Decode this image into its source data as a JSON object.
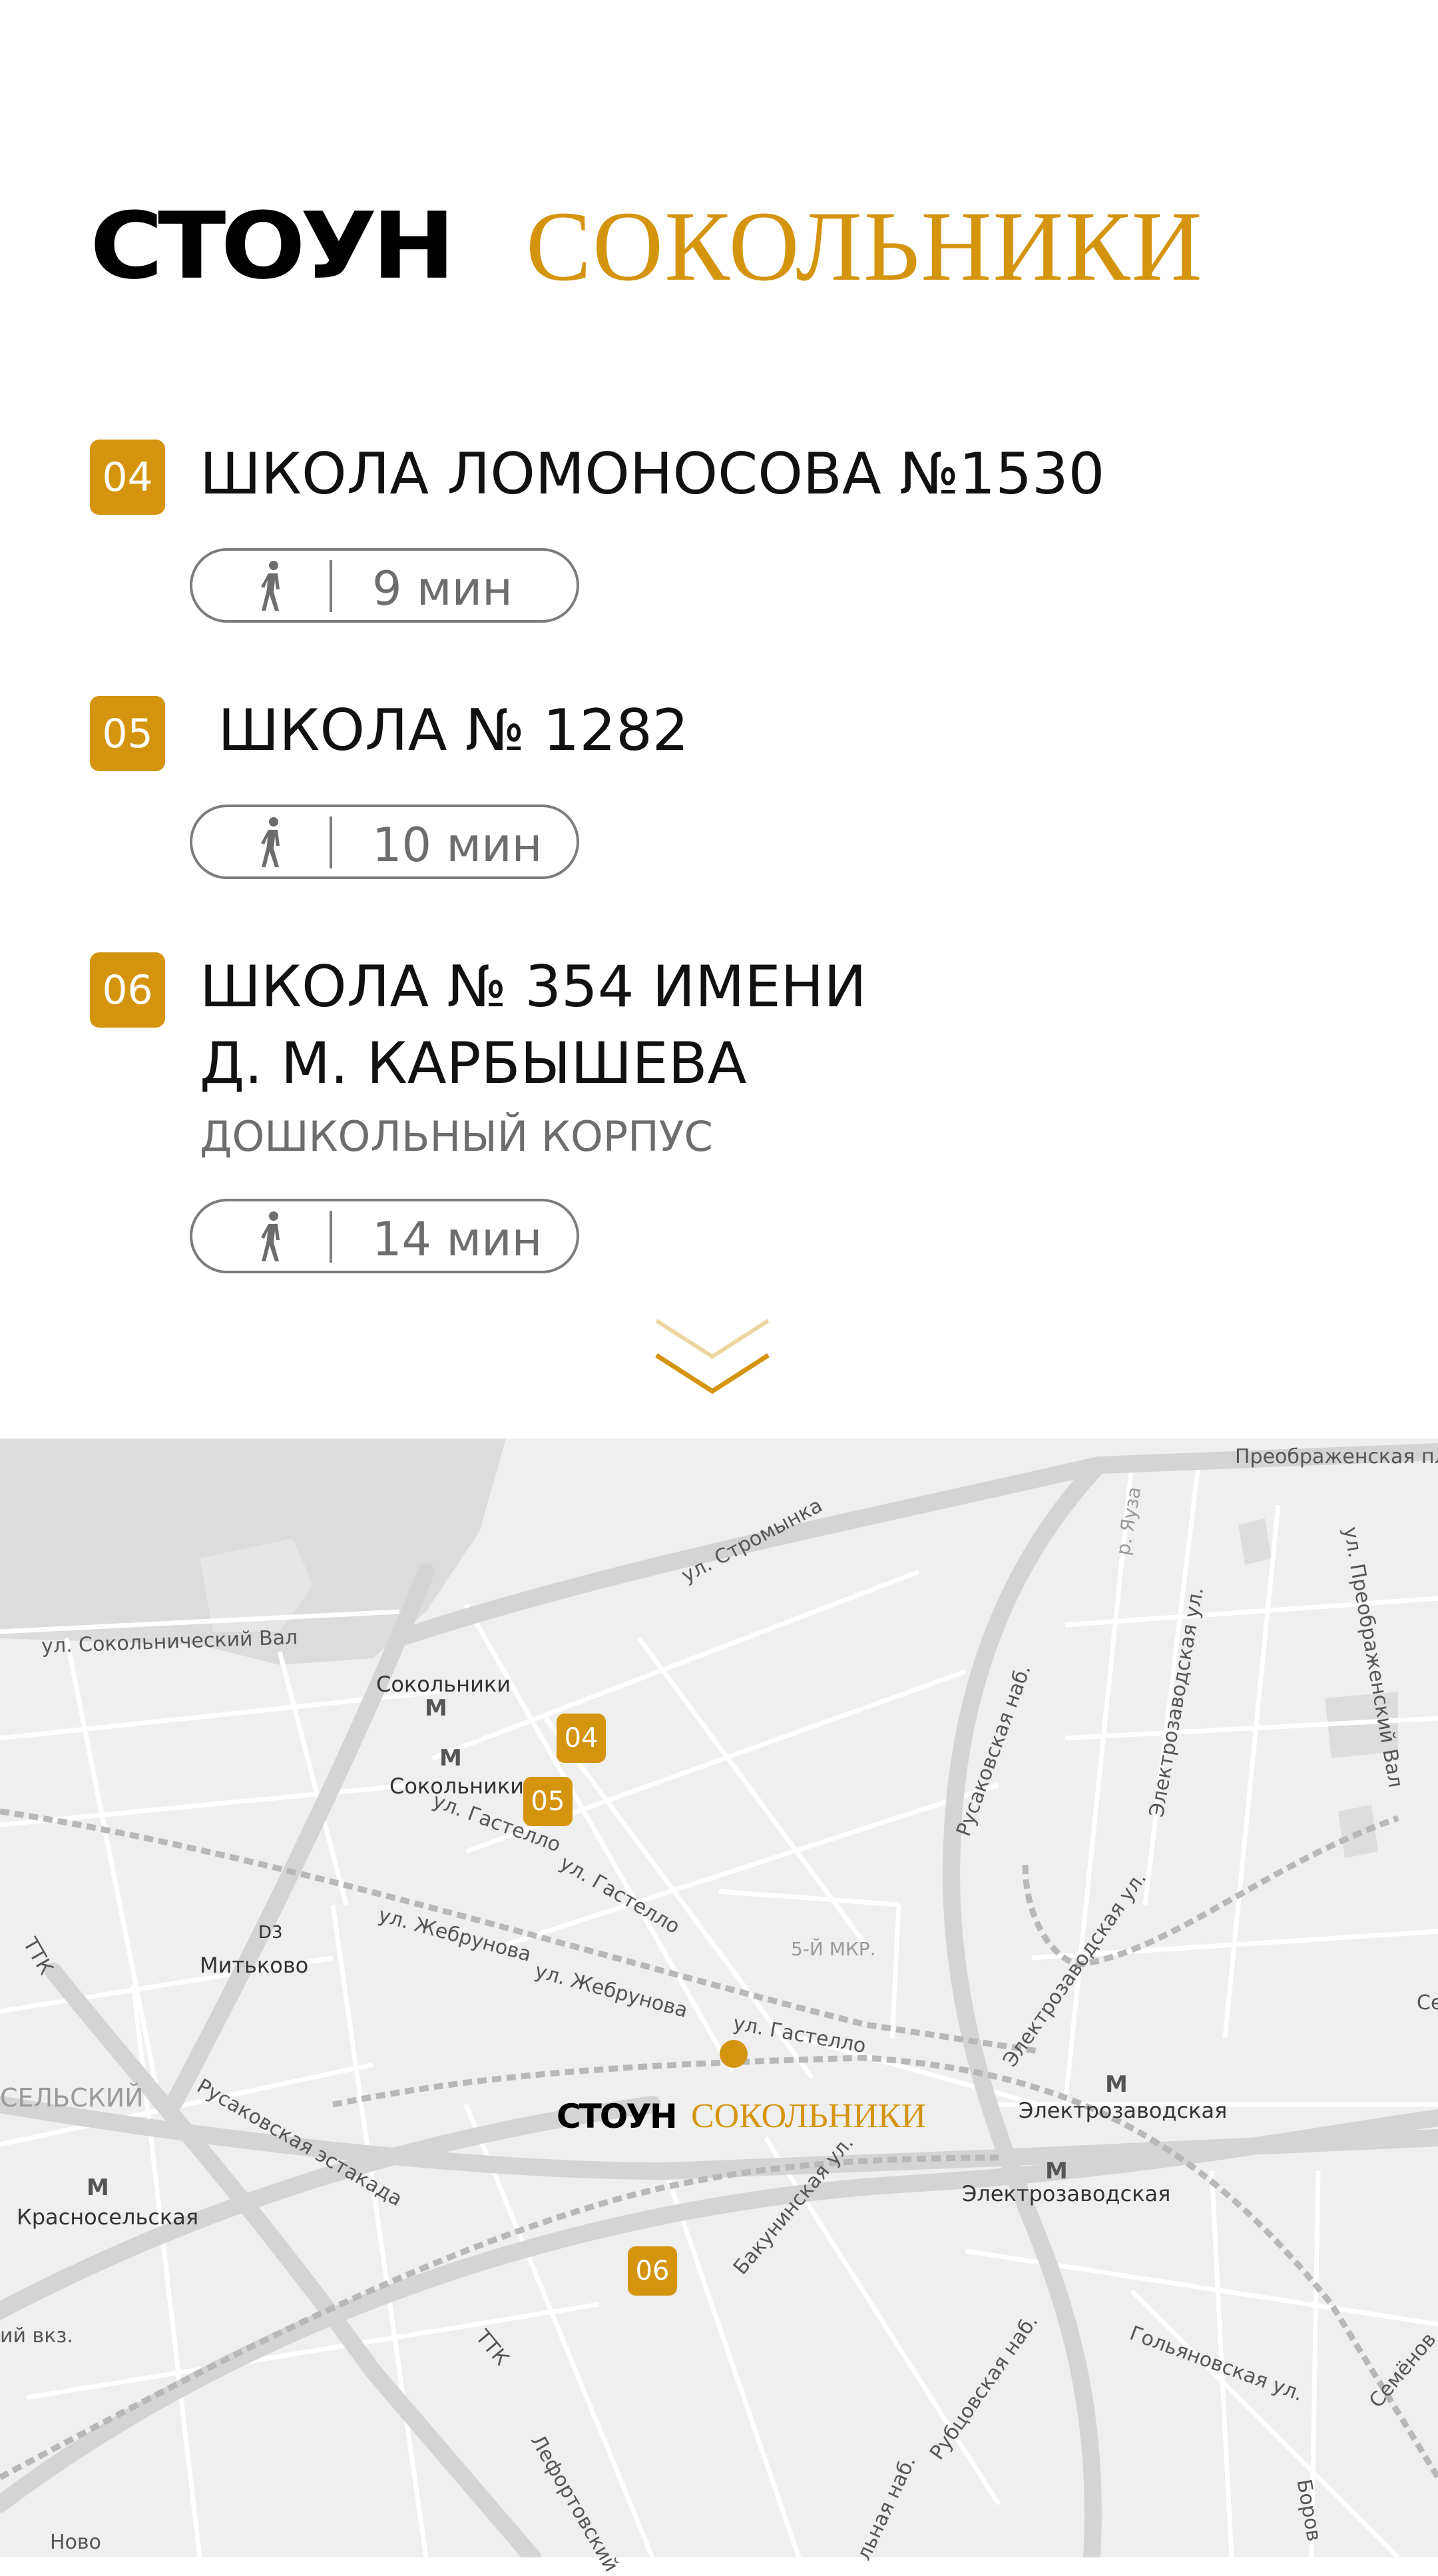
{
  "brand": {
    "part1": "СТОУН",
    "part2": "СОКОЛЬНИКИ",
    "accent_color": "#d4940e"
  },
  "schools": [
    {
      "number": "04",
      "title": "ШКОЛА ЛОМОНОСОВА №1530",
      "subtitle": "",
      "mode": "walk-icon",
      "time": "9 мин"
    },
    {
      "number": "05",
      "title": " ШКОЛА № 1282",
      "subtitle": "",
      "mode": "walk-icon",
      "time": "10 мин"
    },
    {
      "number": "06",
      "title": "ШКОЛА № 354 ИМЕНИ\nД. М. КАРБЫШЕВА",
      "subtitle": "ДОШКОЛЬНЫЙ КОРПУС",
      "mode": "walk-icon",
      "time": "14 мин"
    }
  ],
  "scroll_icon": "chevron-down-icon",
  "map": {
    "labels": {
      "preobr_pl": "Преображенская пл",
      "stromynka": "ул. Стромынка",
      "yauza": "р. Яуза",
      "preobr_val": "ул. Преображенский Вал",
      "sokol_val": "ул. Сокольнический Вал",
      "rusak_nab": "Русаковская наб.",
      "elektrozav_ul": "Электрозаводская ул.",
      "gastello1": "ул. Гастелло",
      "gastello2": "ул. Гастелло",
      "gastello3": "ул. Гастелло",
      "zhebrunova1": "ул. Жебрунова",
      "zhebrunova2": "ул. Жебрунова",
      "mkr5": "5-Й МКР.",
      "elektrozav_ul2": "Электрозаводская ул.",
      "ttk1": "ТТК",
      "seliskiy": "СЕЛЬСКИЙ",
      "rusak_est": "Русаковская эстакада",
      "bakuninskaya": "Бакунинская ул.",
      "vkz": "ий вкз.",
      "ttk2": "ТТК",
      "rubtsov": "Рубцовская наб.",
      "golyanovskaya": "Гольяновская ул.",
      "semenov": "Семёнов",
      "lefort": "Лефортовский",
      "nab_bottom": "льная наб.",
      "borov": "Боров",
      "novo": "Ново",
      "se": "Се"
    },
    "stations": {
      "sokolniki1": "Сокольники",
      "sokolniki2": "Сокольники",
      "mitkovo": "Митьково",
      "d3": "D3",
      "elektrozav1": "Электрозаводская",
      "elektrozav2": "Электрозаводская",
      "krasnosel": "Красносельская"
    },
    "markers": {
      "m04": "04",
      "m05": "05",
      "m06": "06"
    },
    "project_marker": {
      "part1": "СТОУН",
      "part2": "СОКОЛЬНИКИ"
    }
  }
}
